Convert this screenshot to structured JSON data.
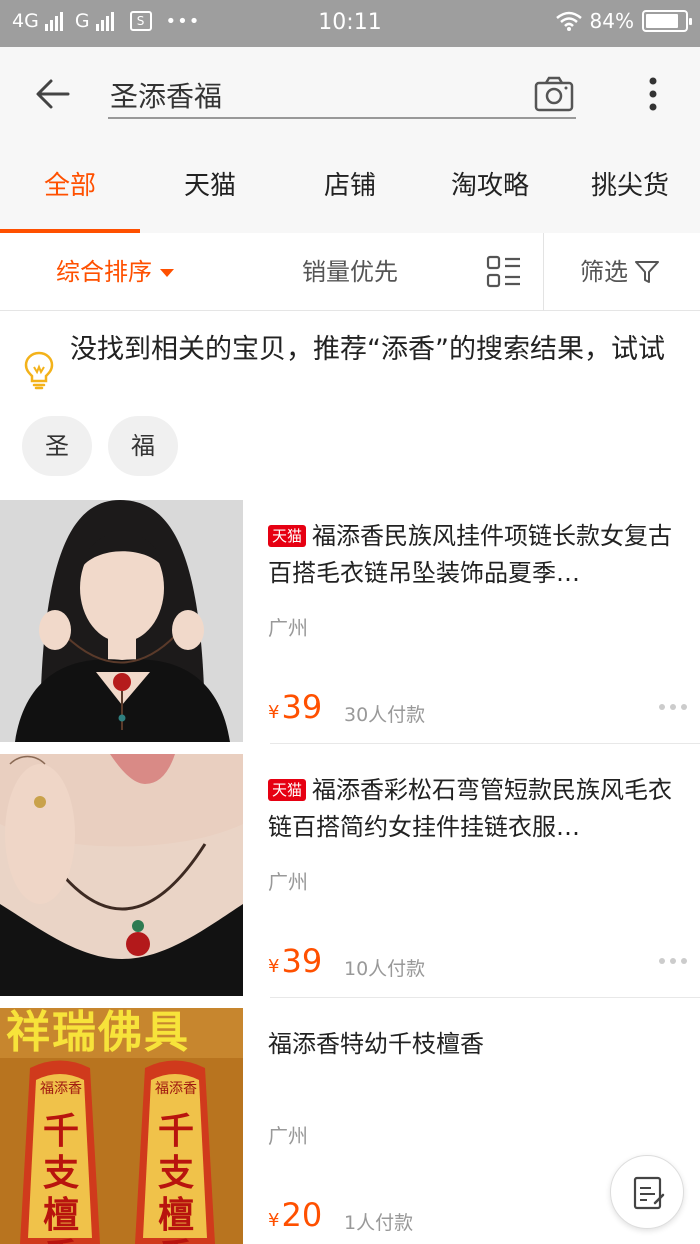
{
  "status_bar": {
    "network_left": "4G",
    "network_right": "G",
    "sim_icon_label": "S",
    "more": "•••",
    "time": "10:11",
    "battery_percent": "84%",
    "battery_level": 0.84
  },
  "search": {
    "query": "圣添香福"
  },
  "tabs": [
    {
      "label": "全部",
      "active": true
    },
    {
      "label": "天猫",
      "active": false
    },
    {
      "label": "店铺",
      "active": false
    },
    {
      "label": "淘攻略",
      "active": false
    },
    {
      "label": "挑尖货",
      "active": false
    }
  ],
  "sort": {
    "default_label": "综合排序",
    "sales_label": "销量优先",
    "filter_label": "筛选"
  },
  "notice": {
    "text": "没找到相关的宝贝，推荐“添香”的搜索结果，试试",
    "chips": [
      "圣",
      "福"
    ]
  },
  "items": [
    {
      "tag": "天猫",
      "title": "福添香民族风挂件项链长款女复古百搭毛衣链吊坠装饰品夏季…",
      "location": "广州",
      "currency": "¥",
      "price": "39",
      "sales": "30人付款"
    },
    {
      "tag": "天猫",
      "title": "福添香彩松石弯管短款民族风毛衣链百搭简约女挂件挂链衣服…",
      "location": "广州",
      "currency": "¥",
      "price": "39",
      "sales": "10人付款"
    },
    {
      "tag": "",
      "title": "福添香特幼千枝檀香",
      "location": "广州",
      "currency": "¥",
      "price": "20",
      "sales": "1人付款",
      "image_text": {
        "banner": "祥瑞佛具",
        "brand": "福添香",
        "product": "千支檀香"
      }
    }
  ],
  "colors": {
    "accent": "#ff5000",
    "tmall_red": "#e60012",
    "status_bar": "#9e9e9e"
  },
  "icons": [
    "back-arrow-icon",
    "camera-icon",
    "more-vertical-icon",
    "list-view-icon",
    "filter-funnel-icon",
    "lightbulb-icon",
    "more-horizontal-icon",
    "edit-note-icon"
  ]
}
